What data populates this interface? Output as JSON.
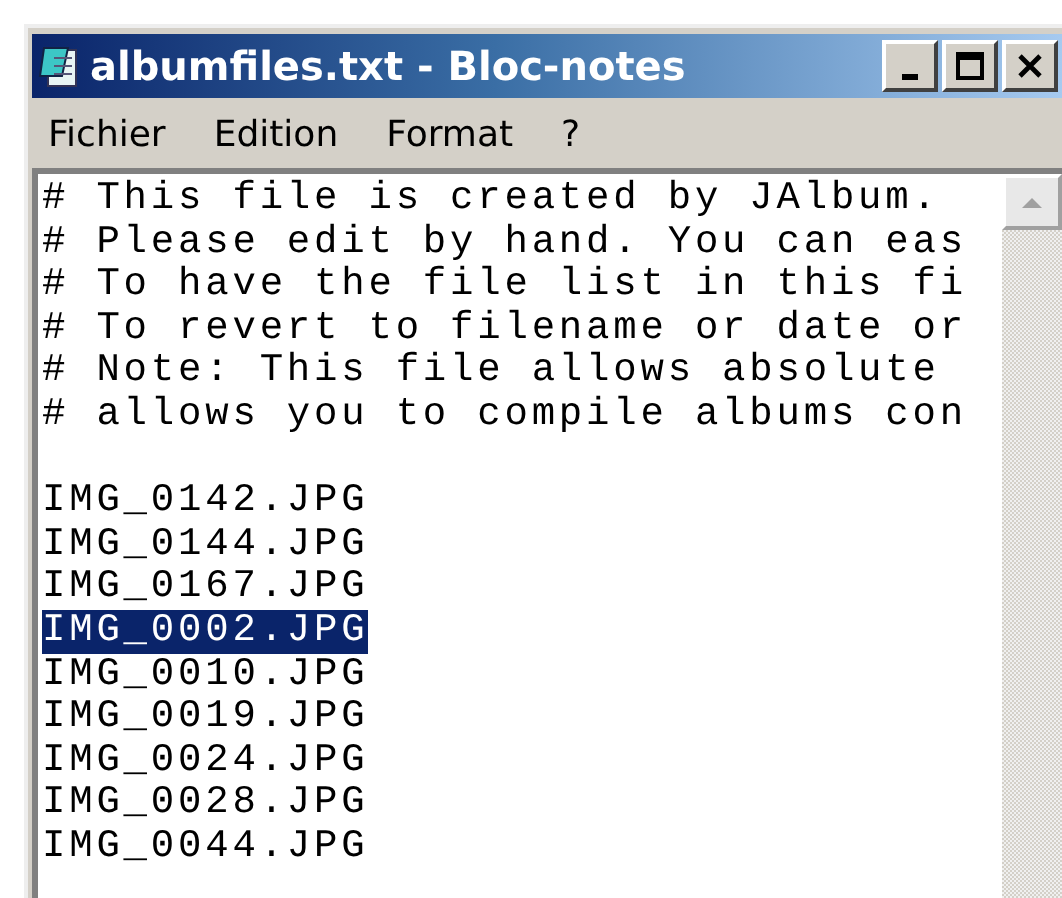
{
  "window": {
    "title": "albumfiles.txt - Bloc-notes"
  },
  "menu": [
    "Fichier",
    "Edition",
    "Format",
    "?"
  ],
  "comments": [
    "# This file is created by JAlbum.",
    "# Please edit by hand. You can eas",
    "# To have the file list in this fi",
    "# To revert to filename or date or",
    "# Note: This file allows absolute",
    "# allows you to compile albums con"
  ],
  "files": [
    {
      "text": "IMG_0142.JPG",
      "selected": false
    },
    {
      "text": "IMG_0144.JPG",
      "selected": false
    },
    {
      "text": "IMG_0167.JPG",
      "selected": false
    },
    {
      "text": "IMG_0002.JPG",
      "selected": true
    },
    {
      "text": "IMG_0010.JPG",
      "selected": false
    },
    {
      "text": "IMG_0019.JPG",
      "selected": false
    },
    {
      "text": "IMG_0024.JPG",
      "selected": false
    },
    {
      "text": "IMG_0028.JPG",
      "selected": false
    },
    {
      "text": "IMG_0044.JPG",
      "selected": false
    }
  ]
}
